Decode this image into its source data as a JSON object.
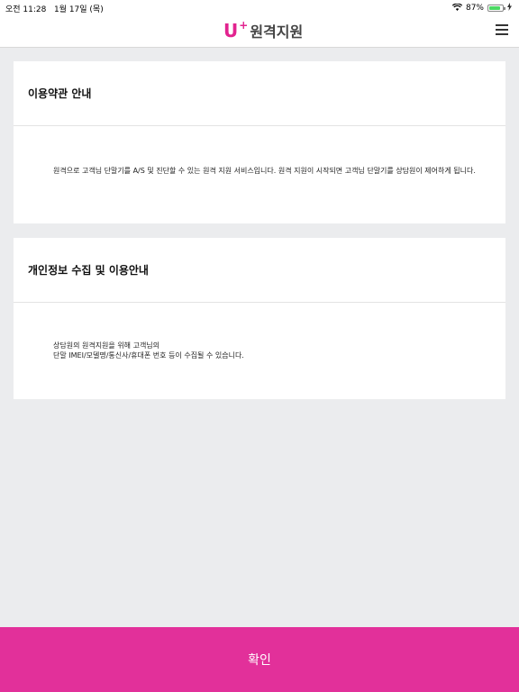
{
  "status_bar": {
    "time": "오전 11:28",
    "date": "1월 17일 (목)",
    "battery_percent": "87%",
    "battery_level": 0.87
  },
  "header": {
    "logo_letter": "U",
    "logo_plus": "+",
    "title": "원격지원",
    "brand_color": "#e2238f"
  },
  "sections": [
    {
      "title": "이용약관 안내",
      "body": "원격으로 고객님 단말기를 A/S 및 진단할 수 있는 원격 지원 서비스입니다. 원격 지원이 시작되면 고객님 단말기를 상담원이 제어하게 됩니다."
    },
    {
      "title": "개인정보 수집 및 이용안내",
      "body_lines": [
        "상담원의 원격지원을 위해 고객님의",
        "단말 IMEI/모델명/통신사/휴대폰 번호 등이 수집될 수 있습니다."
      ]
    }
  ],
  "footer": {
    "confirm_label": "확인",
    "confirm_color": "#e2309a"
  },
  "icons": [
    "wifi-icon",
    "battery-icon",
    "charging-icon",
    "menu-icon"
  ]
}
